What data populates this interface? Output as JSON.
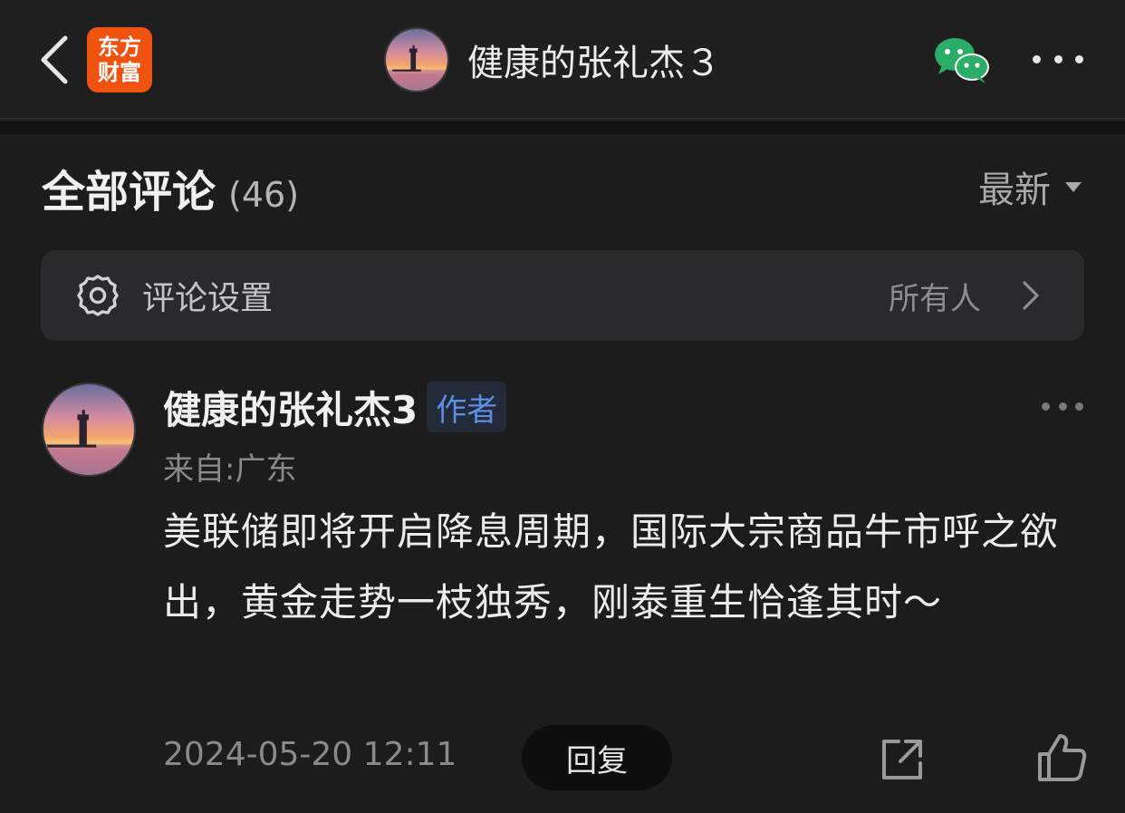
{
  "header": {
    "app_logo_line1": "东方",
    "app_logo_line2": "财富",
    "title": "健康的张礼杰３"
  },
  "comments_section": {
    "title": "全部评论",
    "count": "(46)",
    "sort_label": "最新"
  },
  "settings": {
    "label": "评论设置",
    "value": "所有人"
  },
  "comment": {
    "author": "健康的张礼杰3",
    "badge": "作者",
    "location": "来自:广东",
    "text": "美联储即将开启降息周期，国际大宗商品牛市呼之欲出，黄金走势一枝独秀，刚泰重生恰逢其时～",
    "time": "2024-05-20 12:11",
    "reply_label": "回复"
  },
  "colors": {
    "background": "#1c1c1d",
    "logo_orange": "#f0520f",
    "wechat_green": "#2aae67",
    "badge_blue": "#5d8fe3"
  },
  "icons": [
    "back-arrow-icon",
    "wechat-icon",
    "more-icon",
    "gear-icon",
    "chevron-right-icon",
    "share-icon",
    "thumbs-up-icon"
  ]
}
